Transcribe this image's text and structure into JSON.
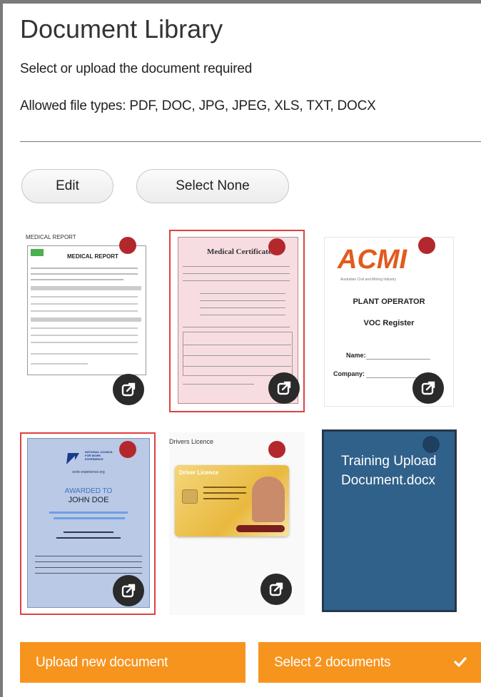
{
  "header": {
    "title": "Document Library",
    "subtitle": "Select or upload the document required",
    "allowed_types": "Allowed file types: PDF, DOC, JPG, JPEG, XLS, TXT, DOCX"
  },
  "actions": {
    "edit_label": "Edit",
    "select_none_label": "Select None"
  },
  "documents": [
    {
      "name": "medical-report",
      "doc_title": "MEDICAL REPORT",
      "heading": "MEDICAL REPORT",
      "selected": false
    },
    {
      "name": "medical-certificate",
      "heading": "Medical Certificate",
      "selected": true
    },
    {
      "name": "acmi-voc-register",
      "logo_text": "ACMI",
      "logo_sub": "Australian Civil and Mining Industry",
      "line1": "PLANT OPERATOR",
      "line2": "VOC Register",
      "field_name": "Name:",
      "field_company": "Company:",
      "selected": false
    },
    {
      "name": "work-experience-certificate",
      "org": "NATIONAL COUNCIL FOR WORK EXPERIENCE",
      "site": "work-experience.org",
      "awarded": "AWARDED TO",
      "person": "JOHN DOE",
      "selected": true
    },
    {
      "name": "drivers-licence",
      "doc_title": "Drivers Licence",
      "card_title": "Driver Licence",
      "selected": false
    },
    {
      "name": "training-upload",
      "label": "Training Upload Document.docx",
      "selected": false
    }
  ],
  "footer": {
    "upload_label": "Upload new document",
    "select_label": "Select 2 documents"
  },
  "colors": {
    "accent_orange": "#f7941d",
    "selected_border": "#e04040",
    "docx_tile": "#30618a",
    "dot_red": "#b3282d"
  },
  "icons": [
    "external-link-icon",
    "checkmark-icon"
  ]
}
